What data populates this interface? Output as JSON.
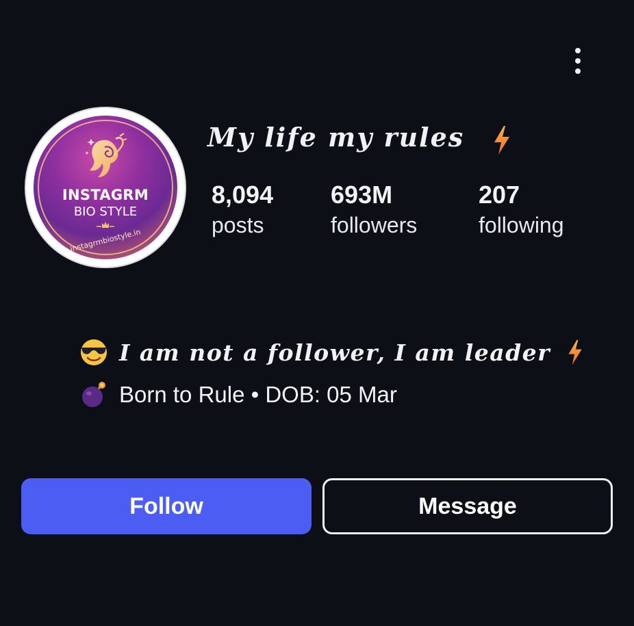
{
  "header": {
    "menu_icon": "more-vertical-icon"
  },
  "avatar": {
    "title": "INSTAGRM",
    "subtitle": "BIO STYLE",
    "url": "instagrmbiostyle.in"
  },
  "profile": {
    "name": "My life my rules",
    "name_emoji": "lightning-icon"
  },
  "stats": [
    {
      "value": "8,094",
      "label": "posts"
    },
    {
      "value": "693M",
      "label": "followers"
    },
    {
      "value": "207",
      "label": "following"
    }
  ],
  "bio": {
    "line1": {
      "emoji": "smiling-face-with-sunglasses-icon",
      "text": "I am not a follower, I am leader",
      "trailing_emoji": "lightning-icon"
    },
    "line2": {
      "emoji": "bomb-icon",
      "text": "Born to Rule • DOB: 05 Mar"
    }
  },
  "actions": {
    "follow_label": "Follow",
    "message_label": "Message"
  },
  "colors": {
    "background": "#0d0f16",
    "follow_button": "#4c5df3",
    "text": "#f4f4f6",
    "lightning": "#f39a3a"
  }
}
